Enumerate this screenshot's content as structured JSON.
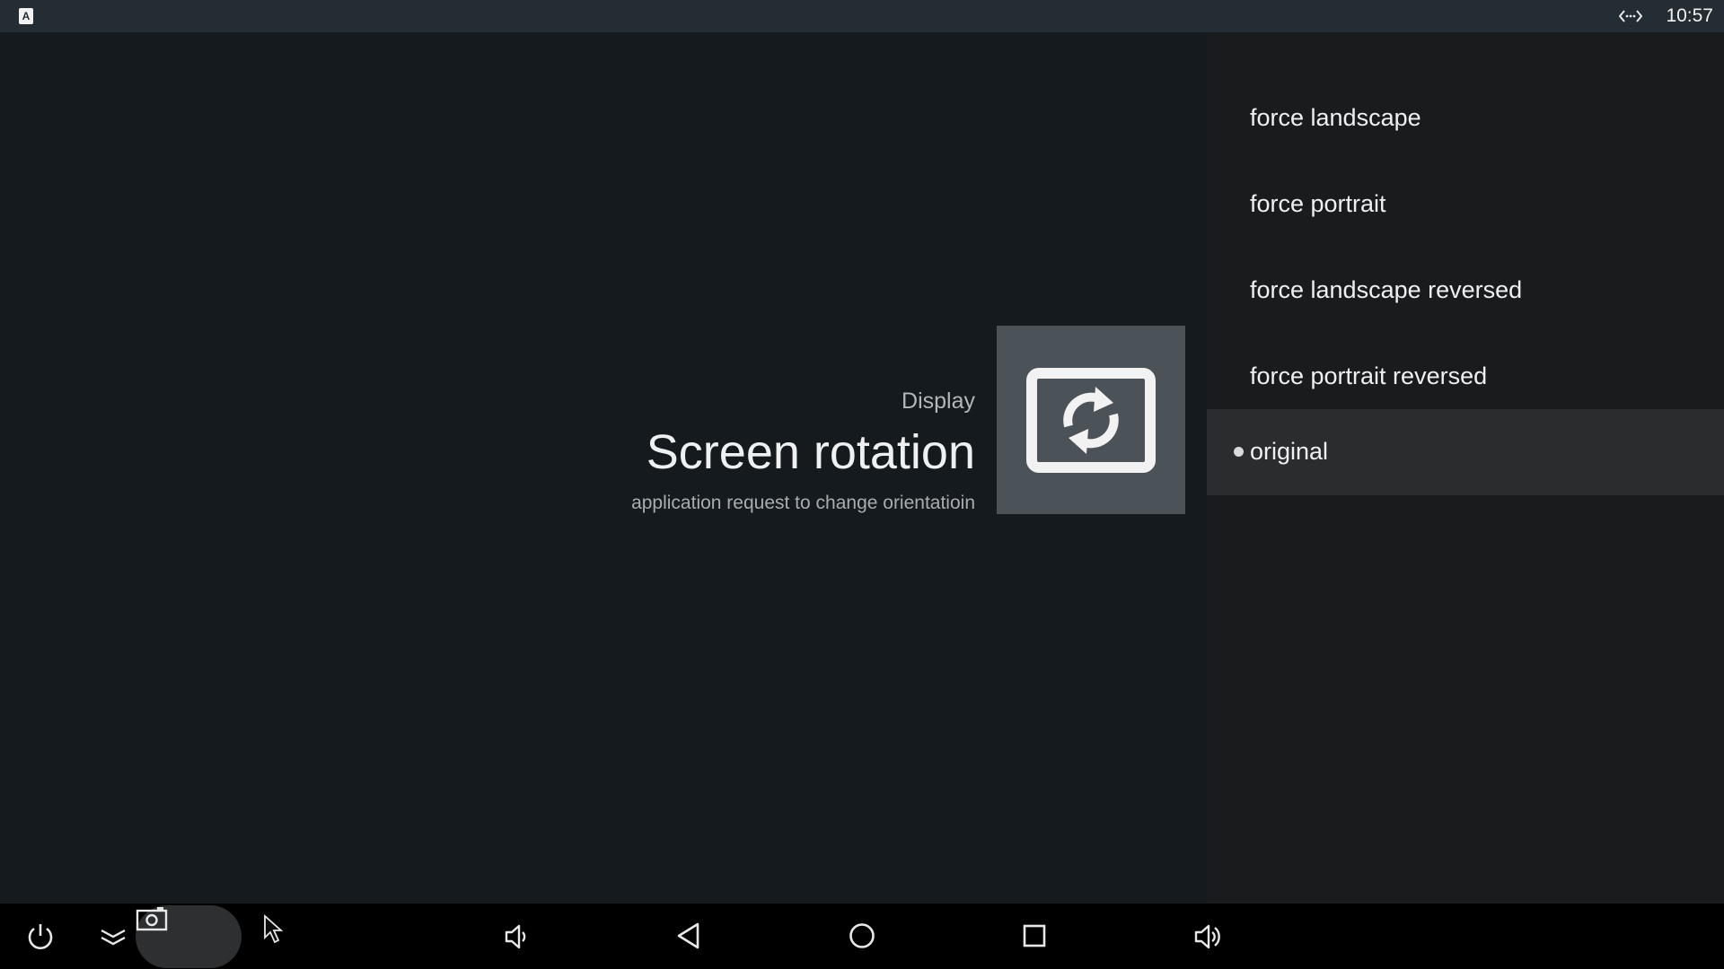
{
  "status_bar": {
    "notification_icon": "a-letter-icon",
    "notification_letter": "A",
    "network_icon": "ethernet-icon",
    "time": "10:57"
  },
  "guidance": {
    "breadcrumb": "Display",
    "title": "Screen rotation",
    "description": "application request to change orientatioin",
    "icon": "screen-rotation-icon"
  },
  "options": {
    "items": [
      {
        "label": "force landscape",
        "selected": false
      },
      {
        "label": "force portrait",
        "selected": false
      },
      {
        "label": "force landscape reversed",
        "selected": false
      },
      {
        "label": "force portrait reversed",
        "selected": false
      },
      {
        "label": "original",
        "selected": true
      }
    ]
  },
  "nav_bar": {
    "buttons": [
      {
        "name": "power",
        "icon": "power-icon"
      },
      {
        "name": "collapse",
        "icon": "chevron-double-down-icon"
      },
      {
        "name": "screenshot",
        "icon": "camera-icon"
      },
      {
        "name": "volume-down",
        "icon": "volume-down-icon"
      },
      {
        "name": "back",
        "icon": "back-triangle-icon"
      },
      {
        "name": "home",
        "icon": "home-circle-icon"
      },
      {
        "name": "recents",
        "icon": "recents-square-icon"
      },
      {
        "name": "volume-up",
        "icon": "volume-up-icon"
      }
    ]
  },
  "colors": {
    "background": "#141a1e",
    "status_bar": "#242d33",
    "side_panel": "#191b1d",
    "selected_row": "#2a2c2e",
    "icon_box": "#4b5258",
    "nav_bar": "#000000"
  }
}
